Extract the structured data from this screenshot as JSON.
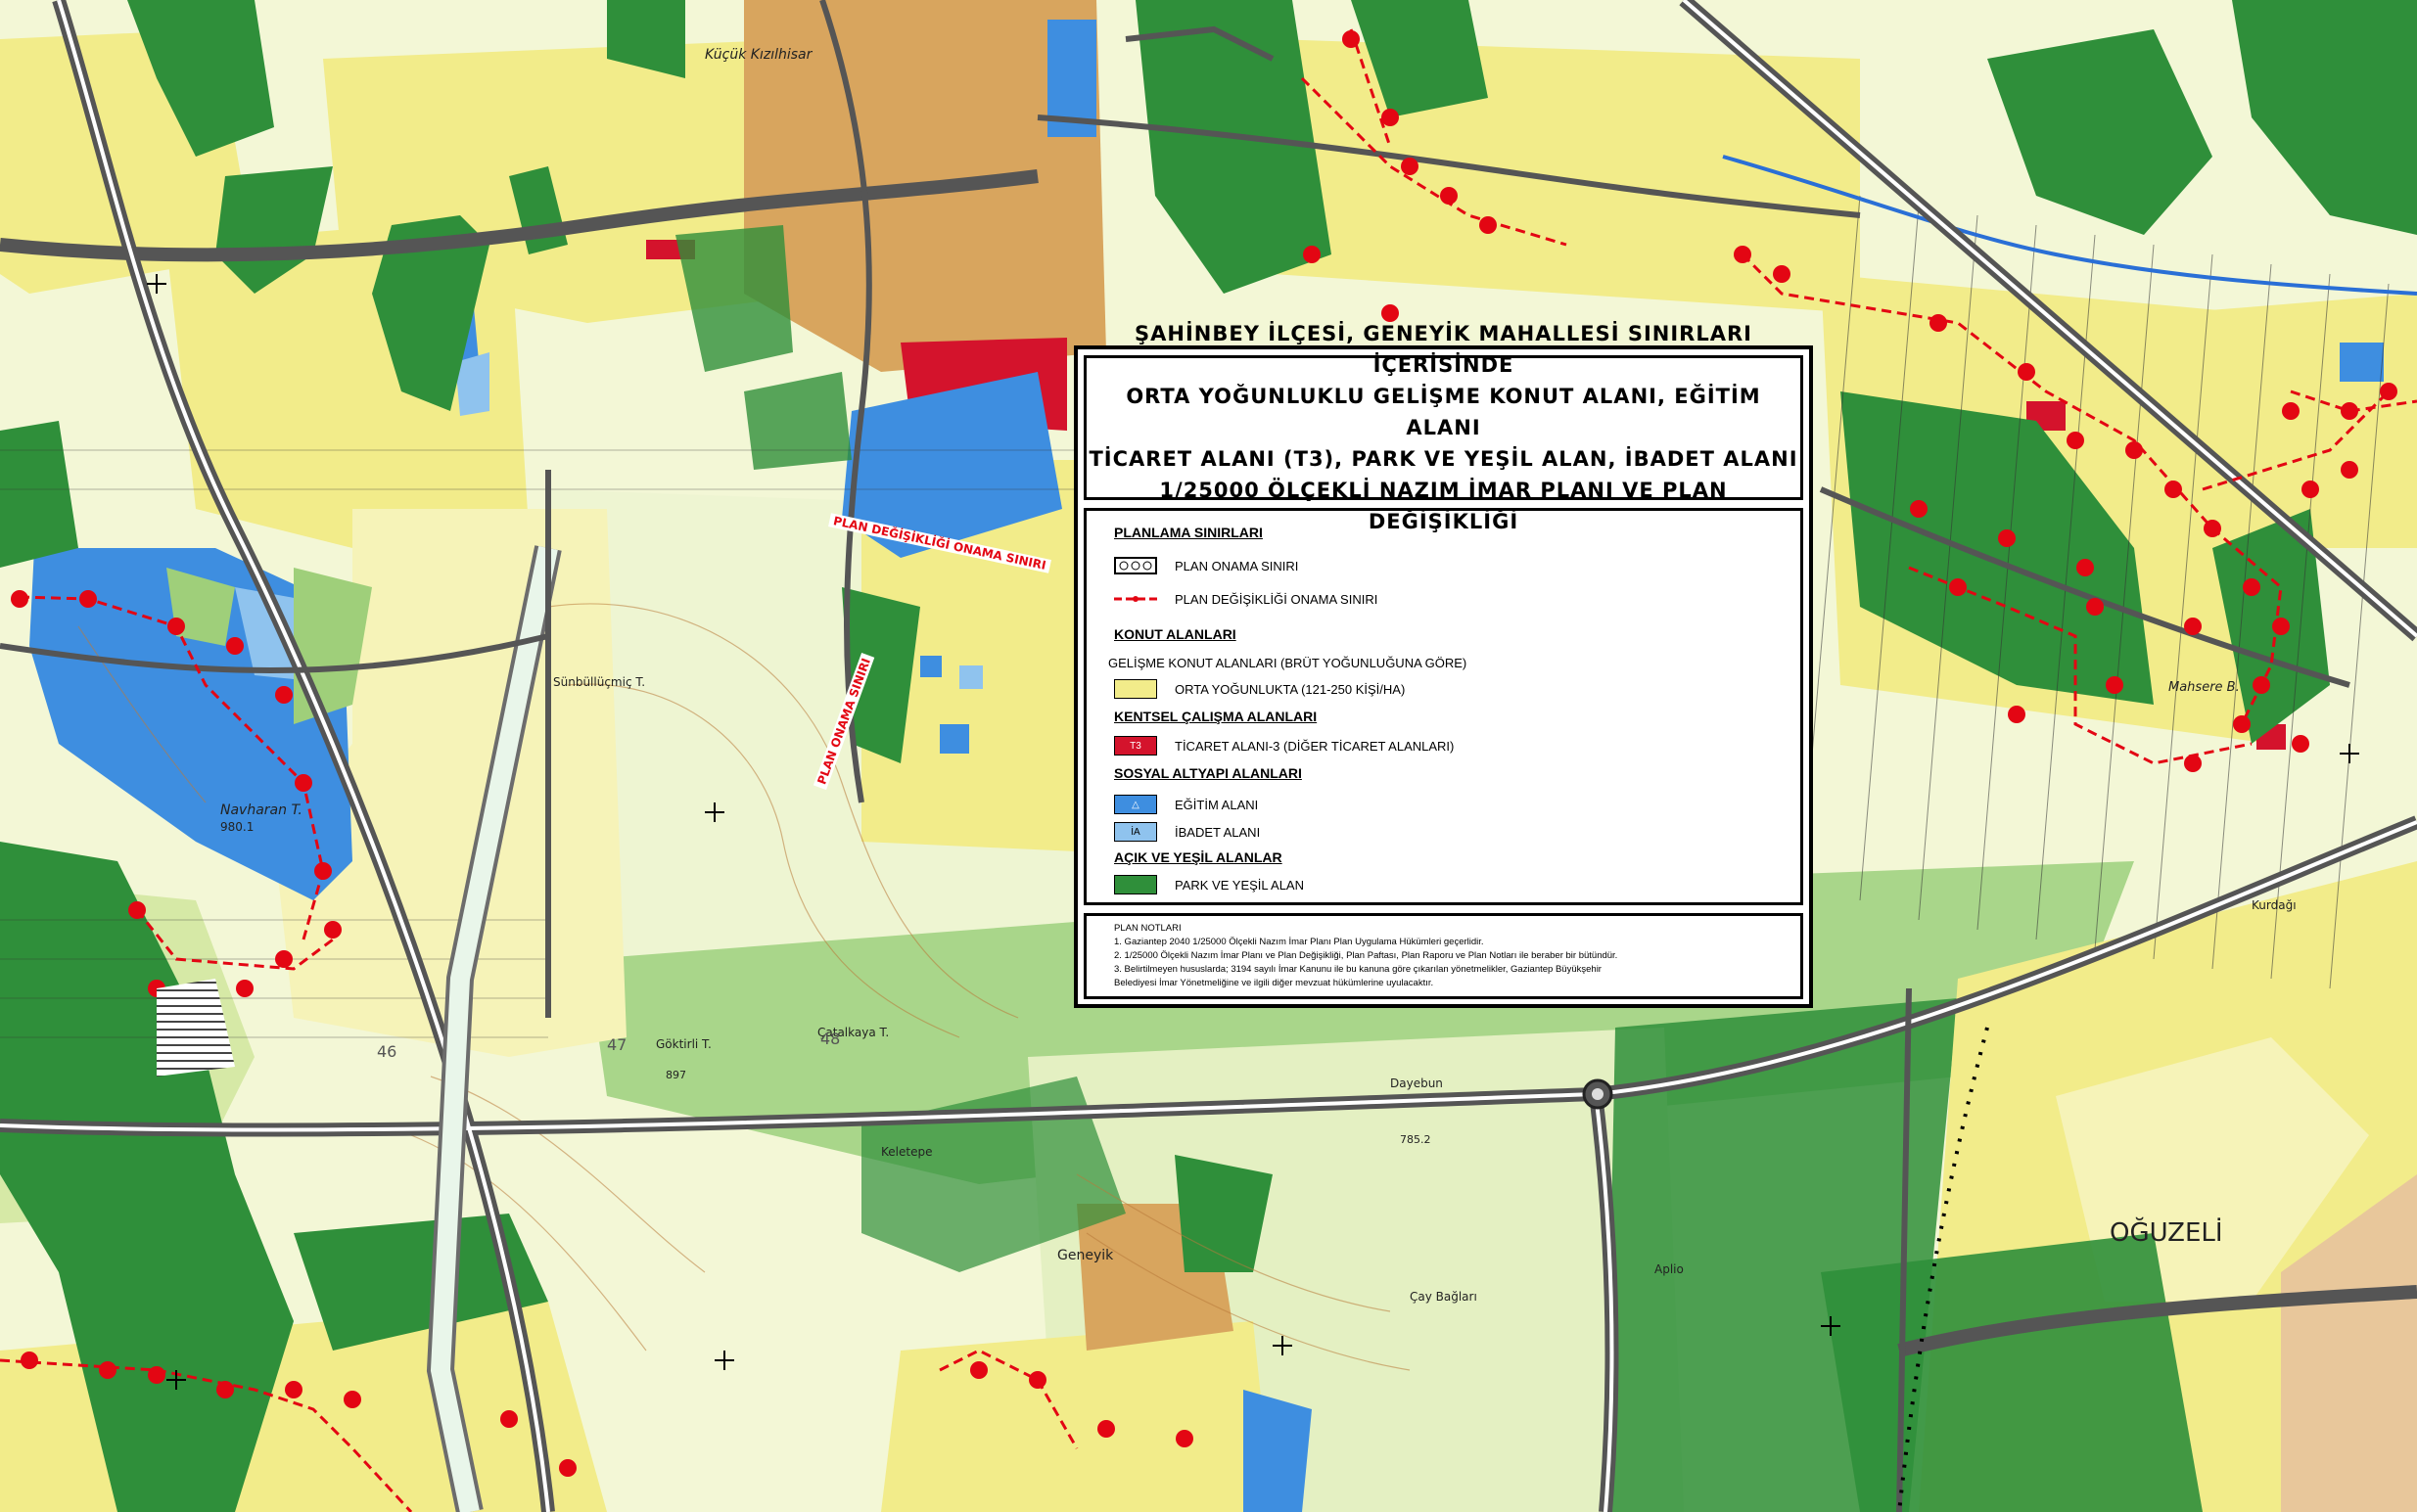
{
  "legend": {
    "title_lines": [
      "ŞAHİNBEY İLÇESİ, GENEYİK MAHALLESİ SINIRLARI İÇERİSİNDE",
      "ORTA YOĞUNLUKLU GELİŞME KONUT ALANI, EĞİTİM ALANI",
      "TİCARET ALANI (T3), PARK VE YEŞİL ALAN, İBADET ALANI",
      "1/25000 ÖLÇEKLİ NAZIM İMAR PLANI VE PLAN DEĞİŞİKLİĞİ"
    ],
    "sections": {
      "planlama": "PLANLAMA SINIRLARI",
      "plan_onama": "PLAN ONAMA SINIRI",
      "plan_degisikligi_onama": "PLAN DEĞİŞİKLİĞİ ONAMA SINIRI",
      "konut": "KONUT ALANLARI",
      "gelisme": "GELİŞME KONUT ALANLARI (BRÜT YOĞUNLUĞUNA GÖRE)",
      "orta": "ORTA YOĞUNLUKTA (121-250 KİŞİ/HA)",
      "kentsel": "KENTSEL ÇALIŞMA ALANLARI",
      "ticaret": "TİCARET ALANI-3 (DİĞER TİCARET ALANLARI)",
      "ticaret_code": "T3",
      "sosyal": "SOSYAL ALTYAPI ALANLARI",
      "egitim": "EĞİTİM ALANI",
      "ibadet": "İBADET ALANI",
      "ibadet_code": "İA",
      "acik": "AÇIK VE YEŞİL ALANLAR",
      "park": "PARK VE YEŞİL ALAN"
    },
    "notes_title": "PLAN NOTLARI",
    "notes": [
      "1. Gaziantep 2040 1/25000 Ölçekli Nazım İmar Planı Plan Uygulama Hükümleri geçerlidir.",
      "2. 1/25000 Ölçekli Nazım İmar Planı ve Plan Değişikliği, Plan Paftası, Plan Raporu ve Plan Notları ile beraber bir bütündür.",
      "3. Belirtilmeyen hususlarda; 3194 sayılı İmar Kanunu ile bu kanuna göre çıkarılan yönetmelikler, Gaziantep Büyükşehir",
      "Belediyesi İmar Yönetmeliğine ve ilgili diğer mevzuat hükümlerine uyulacaktır."
    ]
  },
  "map_labels": {
    "onama_1": "PLAN DEĞİŞİKLİĞİ ONAMA SINIRI",
    "onama_2": "PLAN ONAMA SINIRI",
    "oguzeli": "OĞUZELİ",
    "navharan": "Navharan T.",
    "elev_980": "980.1",
    "sunbulluce": "Sünbüllüçmiç T.",
    "gokirli": "Göktirli T.",
    "elev_897": "897",
    "catalkaya": "Çatalkaya T.",
    "n46": "46",
    "n47": "47",
    "n48": "48",
    "kele": "Keletepe",
    "dayebun": "Dayebun",
    "elev_785": "785.2",
    "geneyik": "Geneyik",
    "cay": "Çay Bağları",
    "kuc": "Küçük Kızılhisar",
    "mahsere": "Mahsere B.",
    "agio": "Aplio",
    "kurdali": "Kurdağı"
  },
  "colors": {
    "base": "#f3f7d6",
    "light_green": "#d6e9a6",
    "mid_green": "#9fcf7a",
    "park_green": "#2f8f3a",
    "yellow": "#f2ec8a",
    "tan": "#d8a55e",
    "blue": "#3e8ee0",
    "light_blue": "#8fc3ee",
    "red": "#d4132c",
    "road": "#555555"
  }
}
